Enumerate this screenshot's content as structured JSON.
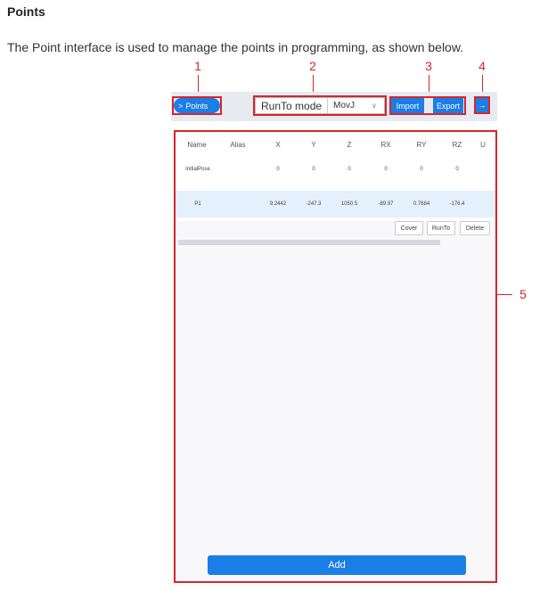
{
  "doc": {
    "heading": "Points",
    "intro": "The Point interface is used to manage the points in programming, as shown below."
  },
  "callouts": [
    "1",
    "2",
    "3",
    "4",
    "5"
  ],
  "toolbar": {
    "points_label": "Points",
    "runto_label": "RunTo mode",
    "runto_value": "MovJ",
    "import_label": "Import",
    "export_label": "Export"
  },
  "table": {
    "columns": [
      "Name",
      "Alias",
      "X",
      "Y",
      "Z",
      "RX",
      "RY",
      "RZ",
      "U"
    ],
    "rows": [
      [
        "InitialPose",
        "",
        "0",
        "0",
        "0",
        "0",
        "0",
        "0",
        ""
      ],
      [
        "P1",
        "",
        "9.2442",
        "-247.3",
        "1050.5",
        "-89.97",
        "0.7684",
        "-176.4",
        ""
      ]
    ]
  },
  "row_actions": {
    "cover_label": "Cover",
    "runto_label": "RunTo",
    "delete_label": "Delete"
  },
  "add_label": "Add",
  "colors": {
    "accent": "#1b7ee6",
    "annotation": "#d9252a",
    "selected_row": "#e5f0fd"
  }
}
